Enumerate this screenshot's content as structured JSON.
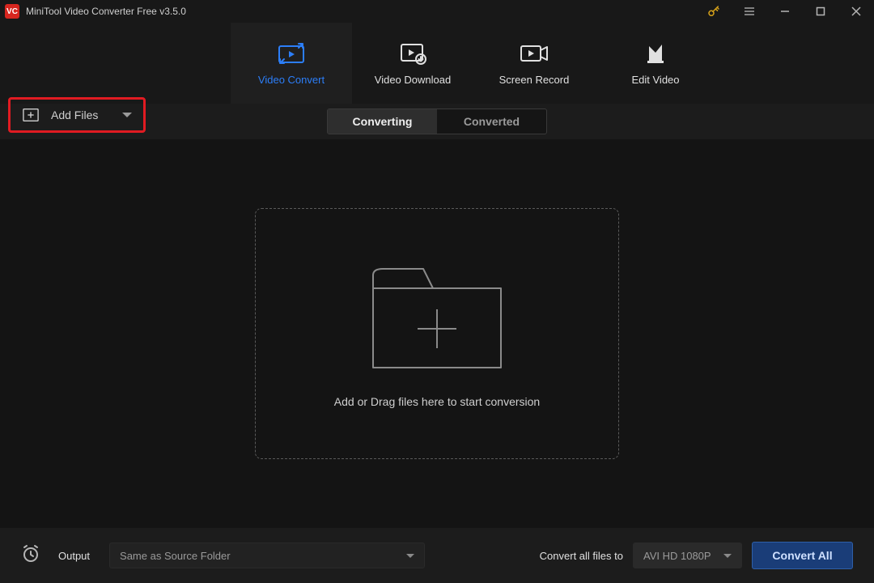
{
  "title": "MiniTool Video Converter Free v3.5.0",
  "logo_text": "VC",
  "header_tabs": [
    {
      "label": "Video Convert"
    },
    {
      "label": "Video Download"
    },
    {
      "label": "Screen Record"
    },
    {
      "label": "Edit Video"
    }
  ],
  "add_files_label": "Add Files",
  "segment": {
    "converting": "Converting",
    "converted": "Converted"
  },
  "dropzone_text": "Add or Drag files here to start conversion",
  "bottom": {
    "output_label": "Output",
    "output_value": "Same as Source Folder",
    "convert_all_label": "Convert all files to",
    "format_value": "AVI HD 1080P",
    "convert_all_button": "Convert All"
  }
}
